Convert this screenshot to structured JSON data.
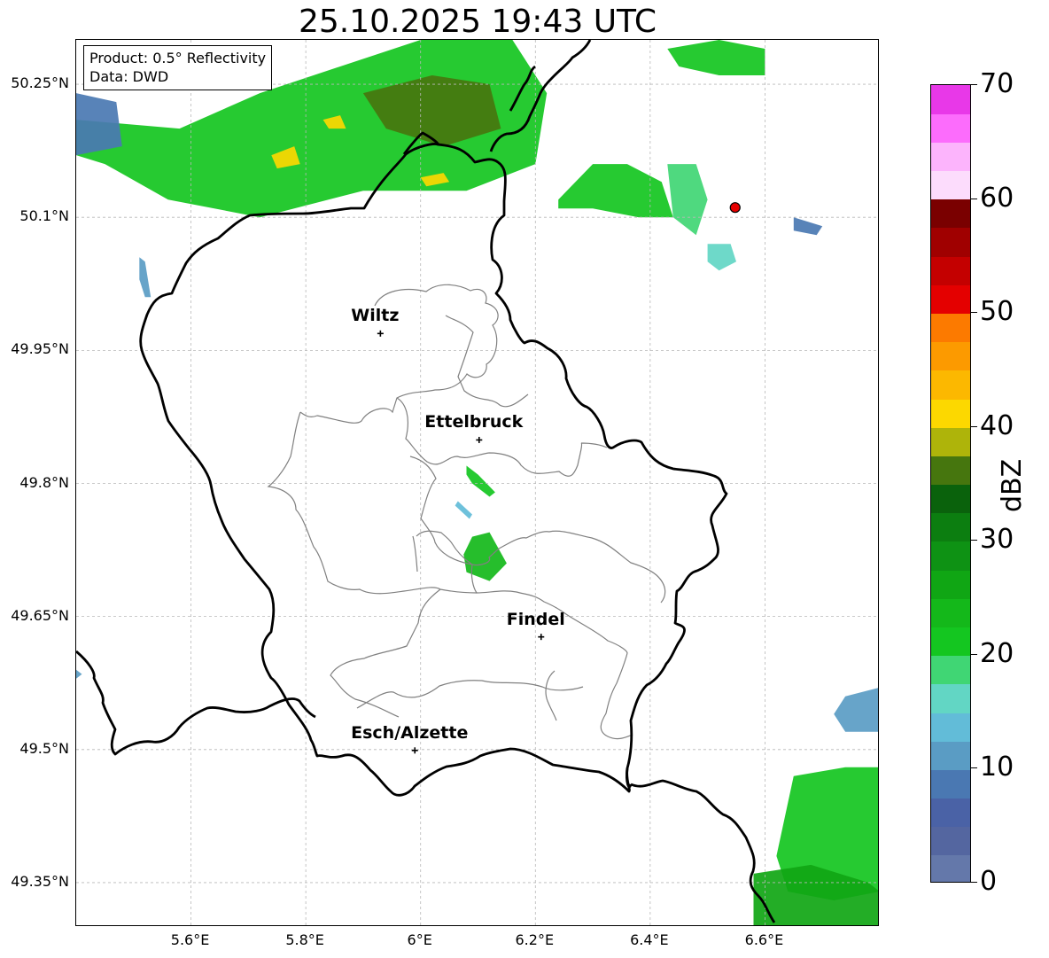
{
  "title": "25.10.2025 19:43 UTC",
  "info_box": {
    "product": "Product: 0.5° Reflectivity",
    "data_source": "Data: DWD"
  },
  "map": {
    "lon_range": [
      5.4,
      6.8
    ],
    "lat_range": [
      49.3,
      50.3
    ],
    "lat_ticks": [
      {
        "value": 50.25,
        "label": "50.25°N"
      },
      {
        "value": 50.1,
        "label": "50.1°N"
      },
      {
        "value": 49.95,
        "label": "49.95°N"
      },
      {
        "value": 49.8,
        "label": "49.8°N"
      },
      {
        "value": 49.65,
        "label": "49.65°N"
      },
      {
        "value": 49.5,
        "label": "49.5°N"
      },
      {
        "value": 49.35,
        "label": "49.35°N"
      }
    ],
    "lon_ticks": [
      {
        "value": 5.6,
        "label": "5.6°E"
      },
      {
        "value": 5.8,
        "label": "5.8°E"
      },
      {
        "value": 6.0,
        "label": "6°E"
      },
      {
        "value": 6.2,
        "label": "6.2°E"
      },
      {
        "value": 6.4,
        "label": "6.4°E"
      },
      {
        "value": 6.6,
        "label": "6.6°E"
      }
    ],
    "gridlines": true,
    "cities": [
      {
        "name": "Wiltz",
        "lon": 5.93,
        "lat": 49.969
      },
      {
        "name": "Ettelbruck",
        "lon": 6.102,
        "lat": 49.849
      },
      {
        "name": "Findel",
        "lon": 6.21,
        "lat": 49.627
      },
      {
        "name": "Esch/Alzette",
        "lon": 5.99,
        "lat": 49.499
      }
    ],
    "radar_site": {
      "lon": 6.548,
      "lat": 50.111,
      "color": "#e60000"
    },
    "reflectivity_areas": [
      {
        "level_dbz": 22,
        "shape": [
          [
            5.4,
            50.21
          ],
          [
            5.58,
            50.2
          ],
          [
            5.72,
            50.24
          ],
          [
            5.86,
            50.27
          ],
          [
            6.0,
            50.3
          ],
          [
            6.16,
            50.3
          ],
          [
            6.22,
            50.24
          ],
          [
            6.2,
            50.16
          ],
          [
            6.08,
            50.13
          ],
          [
            5.9,
            50.13
          ],
          [
            5.72,
            50.1
          ],
          [
            5.56,
            50.12
          ],
          [
            5.45,
            50.16
          ],
          [
            5.4,
            50.17
          ]
        ]
      },
      {
        "level_dbz": 8,
        "shape": [
          [
            5.4,
            50.24
          ],
          [
            5.47,
            50.23
          ],
          [
            5.48,
            50.18
          ],
          [
            5.4,
            50.17
          ]
        ]
      },
      {
        "level_dbz": 36,
        "shape": [
          [
            5.9,
            50.24
          ],
          [
            6.02,
            50.26
          ],
          [
            6.12,
            50.25
          ],
          [
            6.14,
            50.2
          ],
          [
            6.04,
            50.18
          ],
          [
            5.94,
            50.2
          ]
        ]
      },
      {
        "level_dbz": 40,
        "shape": [
          [
            5.74,
            50.17
          ],
          [
            5.78,
            50.18
          ],
          [
            5.79,
            50.16
          ],
          [
            5.75,
            50.155
          ]
        ]
      },
      {
        "level_dbz": 40,
        "shape": [
          [
            6.0,
            50.145
          ],
          [
            6.04,
            50.15
          ],
          [
            6.05,
            50.14
          ],
          [
            6.01,
            50.135
          ]
        ]
      },
      {
        "level_dbz": 40,
        "shape": [
          [
            5.83,
            50.21
          ],
          [
            5.86,
            50.215
          ],
          [
            5.87,
            50.2
          ],
          [
            5.84,
            50.2
          ]
        ]
      },
      {
        "level_dbz": 10,
        "shape": [
          [
            5.51,
            50.055
          ],
          [
            5.52,
            50.05
          ],
          [
            5.53,
            50.01
          ],
          [
            5.52,
            50.01
          ],
          [
            5.51,
            50.03
          ]
        ]
      },
      {
        "level_dbz": 22,
        "shape": [
          [
            6.24,
            50.12
          ],
          [
            6.3,
            50.16
          ],
          [
            6.36,
            50.16
          ],
          [
            6.42,
            50.14
          ],
          [
            6.44,
            50.1
          ],
          [
            6.38,
            50.1
          ],
          [
            6.3,
            50.11
          ],
          [
            6.24,
            50.11
          ]
        ]
      },
      {
        "level_dbz": 18,
        "shape": [
          [
            6.43,
            50.16
          ],
          [
            6.48,
            50.16
          ],
          [
            6.5,
            50.12
          ],
          [
            6.48,
            50.08
          ],
          [
            6.44,
            50.1
          ]
        ]
      },
      {
        "level_dbz": 16,
        "shape": [
          [
            6.5,
            50.07
          ],
          [
            6.54,
            50.07
          ],
          [
            6.55,
            50.05
          ],
          [
            6.52,
            50.04
          ],
          [
            6.5,
            50.05
          ]
        ]
      },
      {
        "level_dbz": 22,
        "shape": [
          [
            6.43,
            50.29
          ],
          [
            6.52,
            50.3
          ],
          [
            6.6,
            50.29
          ],
          [
            6.6,
            50.26
          ],
          [
            6.52,
            50.26
          ],
          [
            6.45,
            50.27
          ]
        ]
      },
      {
        "level_dbz": 8,
        "shape": [
          [
            6.65,
            50.1
          ],
          [
            6.7,
            50.09
          ],
          [
            6.69,
            50.08
          ],
          [
            6.65,
            50.085
          ]
        ]
      },
      {
        "level_dbz": 22,
        "shape": [
          [
            6.08,
            49.82
          ],
          [
            6.1,
            49.81
          ],
          [
            6.13,
            49.79
          ],
          [
            6.12,
            49.785
          ],
          [
            6.09,
            49.8
          ],
          [
            6.08,
            49.81
          ]
        ]
      },
      {
        "level_dbz": 14,
        "shape": [
          [
            6.065,
            49.78
          ],
          [
            6.09,
            49.765
          ],
          [
            6.085,
            49.76
          ],
          [
            6.06,
            49.775
          ]
        ]
      },
      {
        "level_dbz": 24,
        "shape": [
          [
            6.09,
            49.74
          ],
          [
            6.12,
            49.745
          ],
          [
            6.15,
            49.71
          ],
          [
            6.12,
            49.69
          ],
          [
            6.08,
            49.7
          ],
          [
            6.075,
            49.72
          ]
        ]
      },
      {
        "level_dbz": 22,
        "shape": [
          [
            6.65,
            49.47
          ],
          [
            6.74,
            49.48
          ],
          [
            6.8,
            49.48
          ],
          [
            6.8,
            49.34
          ],
          [
            6.72,
            49.33
          ],
          [
            6.64,
            49.34
          ],
          [
            6.62,
            49.38
          ],
          [
            6.64,
            49.44
          ]
        ]
      },
      {
        "level_dbz": 26,
        "shape": [
          [
            6.58,
            49.36
          ],
          [
            6.68,
            49.37
          ],
          [
            6.78,
            49.35
          ],
          [
            6.8,
            49.34
          ],
          [
            6.8,
            49.3
          ],
          [
            6.58,
            49.3
          ]
        ]
      },
      {
        "level_dbz": 10,
        "shape": [
          [
            6.74,
            49.56
          ],
          [
            6.8,
            49.57
          ],
          [
            6.8,
            49.52
          ],
          [
            6.74,
            49.52
          ],
          [
            6.72,
            49.54
          ]
        ]
      },
      {
        "level_dbz": 12,
        "shape": [
          [
            5.4,
            49.59
          ],
          [
            5.41,
            49.585
          ],
          [
            5.4,
            49.58
          ]
        ]
      }
    ]
  },
  "colorbar": {
    "label": "dBZ",
    "min": 0,
    "max": 70,
    "ticks": [
      {
        "value": 0,
        "label": "0"
      },
      {
        "value": 10,
        "label": "10"
      },
      {
        "value": 20,
        "label": "20"
      },
      {
        "value": 30,
        "label": "30"
      },
      {
        "value": 40,
        "label": "40"
      },
      {
        "value": 50,
        "label": "50"
      },
      {
        "value": 60,
        "label": "60"
      },
      {
        "value": 70,
        "label": "70"
      }
    ],
    "bins": [
      {
        "from": 0,
        "to": 2.5,
        "color": "#6478aa"
      },
      {
        "from": 2.5,
        "to": 5,
        "color": "#5466a0"
      },
      {
        "from": 5,
        "to": 7.5,
        "color": "#4a62a6"
      },
      {
        "from": 7.5,
        "to": 10,
        "color": "#4a78b2"
      },
      {
        "from": 10,
        "to": 12.5,
        "color": "#5a9cc4"
      },
      {
        "from": 12.5,
        "to": 15,
        "color": "#62bcd8"
      },
      {
        "from": 15,
        "to": 17.5,
        "color": "#62d6c4"
      },
      {
        "from": 17.5,
        "to": 20,
        "color": "#40d674"
      },
      {
        "from": 20,
        "to": 22.5,
        "color": "#14c620"
      },
      {
        "from": 22.5,
        "to": 25,
        "color": "#14b81a"
      },
      {
        "from": 25,
        "to": 27.5,
        "color": "#10a614"
      },
      {
        "from": 27.5,
        "to": 30,
        "color": "#0e9214"
      },
      {
        "from": 30,
        "to": 32.5,
        "color": "#0c7e10"
      },
      {
        "from": 32.5,
        "to": 35,
        "color": "#0a620c"
      },
      {
        "from": 35,
        "to": 37.5,
        "color": "#46760e"
      },
      {
        "from": 37.5,
        "to": 40,
        "color": "#aeb40a"
      },
      {
        "from": 40,
        "to": 42.5,
        "color": "#fcd800"
      },
      {
        "from": 42.5,
        "to": 45,
        "color": "#fcb800"
      },
      {
        "from": 45,
        "to": 47.5,
        "color": "#fc9a00"
      },
      {
        "from": 47.5,
        "to": 50,
        "color": "#fc7a00"
      },
      {
        "from": 50,
        "to": 52.5,
        "color": "#e40000"
      },
      {
        "from": 52.5,
        "to": 55,
        "color": "#c40000"
      },
      {
        "from": 55,
        "to": 57.5,
        "color": "#a00000"
      },
      {
        "from": 57.5,
        "to": 60,
        "color": "#7a0000"
      },
      {
        "from": 60,
        "to": 62.5,
        "color": "#fcdcfc"
      },
      {
        "from": 62.5,
        "to": 65,
        "color": "#fcb4fc"
      },
      {
        "from": 65,
        "to": 67.5,
        "color": "#fc6cfc"
      },
      {
        "from": 67.5,
        "to": 70,
        "color": "#e838e8"
      }
    ]
  }
}
